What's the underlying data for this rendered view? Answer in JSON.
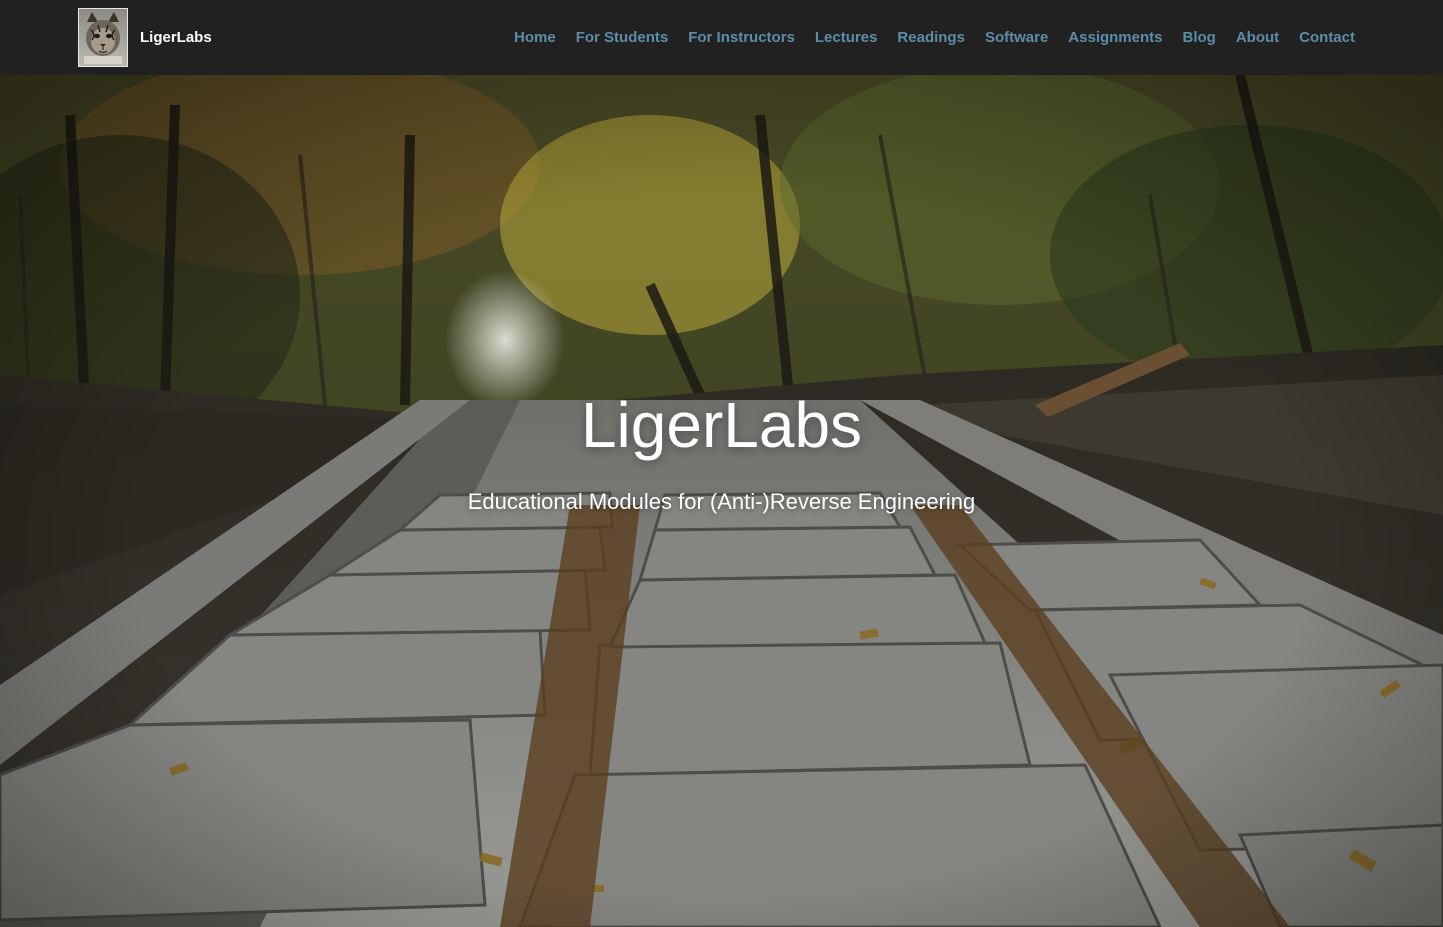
{
  "header": {
    "brand_name": "LigerLabs",
    "logo_icon": "liger-cat-photo-icon",
    "nav": [
      {
        "label": "Home"
      },
      {
        "label": "For Students"
      },
      {
        "label": "For Instructors"
      },
      {
        "label": "Lectures"
      },
      {
        "label": "Readings"
      },
      {
        "label": "Software"
      },
      {
        "label": "Assignments"
      },
      {
        "label": "Blog"
      },
      {
        "label": "About"
      },
      {
        "label": "Contact"
      }
    ]
  },
  "hero": {
    "title": "LigerLabs",
    "subtitle": "Educational Modules for (Anti-)Reverse Engineering"
  },
  "colors": {
    "navbar_bg": "#212121",
    "nav_link": "#5b8ea6",
    "brand_text": "#ffffff",
    "hero_text": "#ffffff"
  }
}
